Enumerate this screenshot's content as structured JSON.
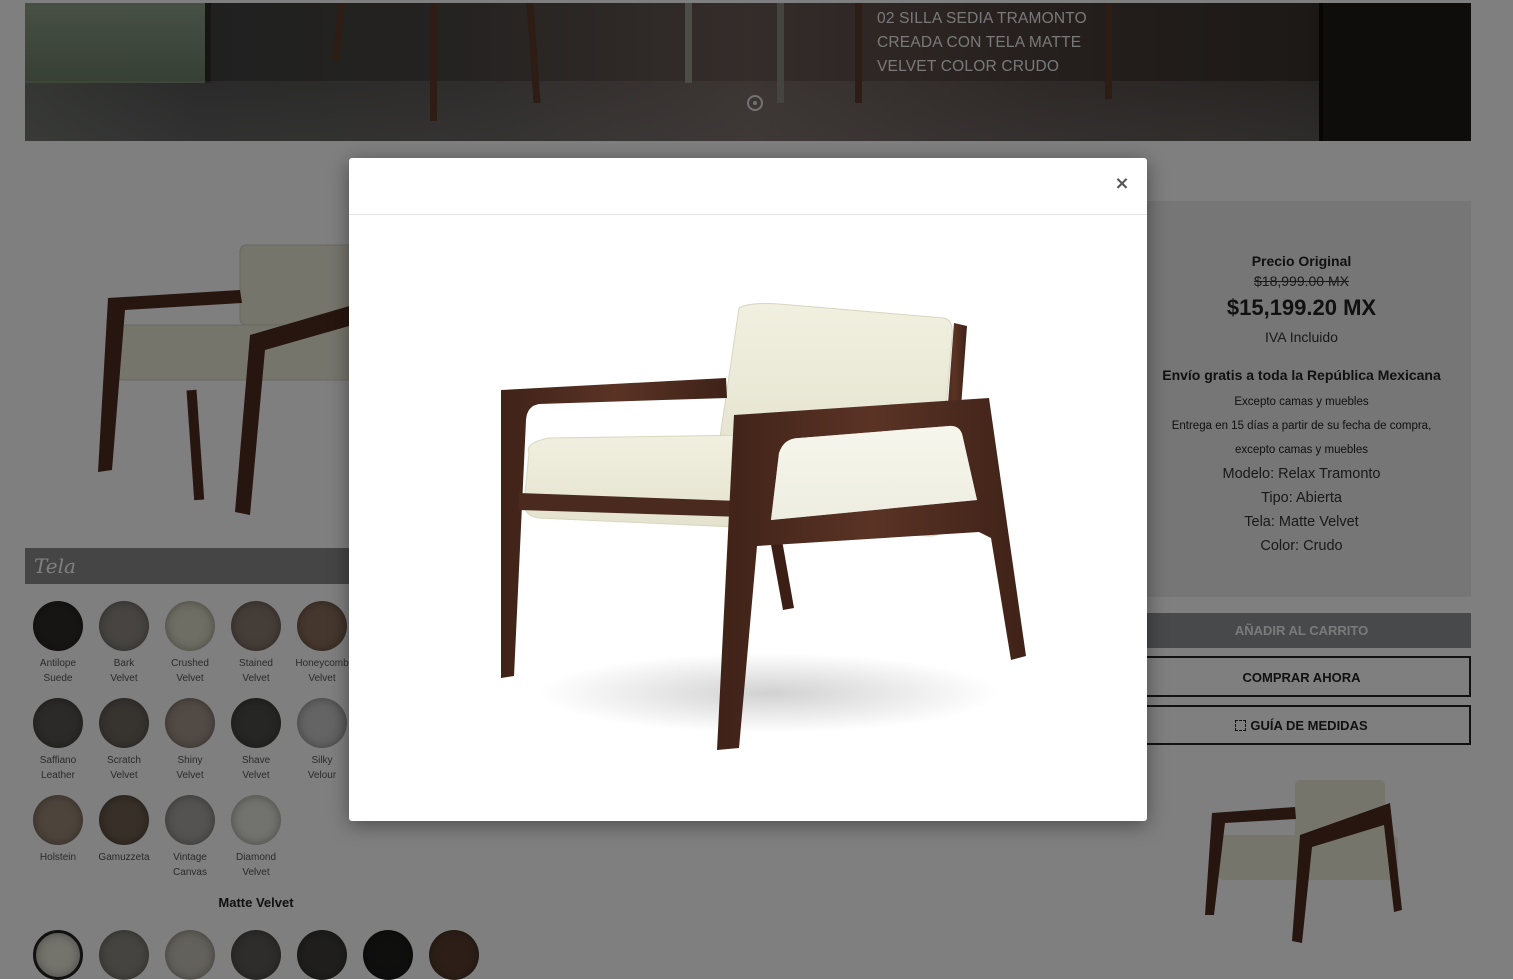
{
  "hero": {
    "caption_lines": [
      "02 SILLA SEDIA TRAMONTO",
      "CREADA CON TELA MATTE",
      "VELVET COLOR CRUDO"
    ],
    "pagination_icon": "carousel-dot-icon"
  },
  "tela": {
    "title": "Tela",
    "swatches": [
      {
        "line1": "Antilope",
        "line2": "Suede",
        "color": "#2f2b29"
      },
      {
        "line1": "Bark",
        "line2": "Velvet",
        "color": "#8e8984"
      },
      {
        "line1": "Crushed",
        "line2": "Velvet",
        "color": "#dcdcc8"
      },
      {
        "line1": "Stained",
        "line2": "Velvet",
        "color": "#8b7a70"
      },
      {
        "line1": "Honeycomb",
        "line2": "Velvet",
        "color": "#8a6f5c"
      },
      {
        "line1": "Saffiano",
        "line2": "Leather",
        "color": "#565450"
      },
      {
        "line1": "Scratch",
        "line2": "Velvet",
        "color": "#6e6860"
      },
      {
        "line1": "Shiny",
        "line2": "Velvet",
        "color": "#a4948a"
      },
      {
        "line1": "Shave",
        "line2": "Velvet",
        "color": "#4c4c48"
      },
      {
        "line1": "Silky",
        "line2": "Velour",
        "color": "#c8c8c8"
      },
      {
        "line1": "Holstein",
        "line2": "",
        "color": "#9b8878"
      },
      {
        "line1": "Gamuzzeta",
        "line2": "",
        "color": "#6e5e50"
      },
      {
        "line1": "Vintage",
        "line2": "Canvas",
        "color": "#a9a6a2"
      },
      {
        "line1": "Diamond",
        "line2": "Velvet",
        "color": "#e4e4dc"
      }
    ],
    "matte_title": "Matte Velvet",
    "matte_colors": [
      "#e8e6d8",
      "#8a8880",
      "#c7c2b6",
      "#5e5a56",
      "#3e3d3a",
      "#1f1e1d",
      "#5a3e30"
    ]
  },
  "info": {
    "original_label": "Precio Original",
    "original_price": "$18,999.00 MX",
    "price": "$15,199.20 MX",
    "iva": "IVA Incluido",
    "shipping": "Envío gratis a toda la República Mexicana",
    "exception": "Excepto camas y muebles",
    "delivery_line1": "Entrega en 15 días a partir de su fecha de compra,",
    "delivery_line2": "excepto camas y muebles",
    "model": "Modelo: Relax Tramonto",
    "type": "Tipo: Abierta",
    "fabric": "Tela: Matte Velvet",
    "color": "Color: Crudo"
  },
  "buttons": {
    "add_to_cart": "AÑADIR AL CARRITO",
    "buy_now": "COMPRAR AHORA",
    "size_guide": "GUÍA DE MEDIDAS",
    "size_guide_icon": "expand-icon"
  },
  "modal": {
    "close_label": "×",
    "image_alt_icon": "armchair-image"
  },
  "colors": {
    "wood": "#4e2b1f",
    "cushion": "#ecebd9",
    "overlay": "rgba(0,0,0,0.5)"
  }
}
